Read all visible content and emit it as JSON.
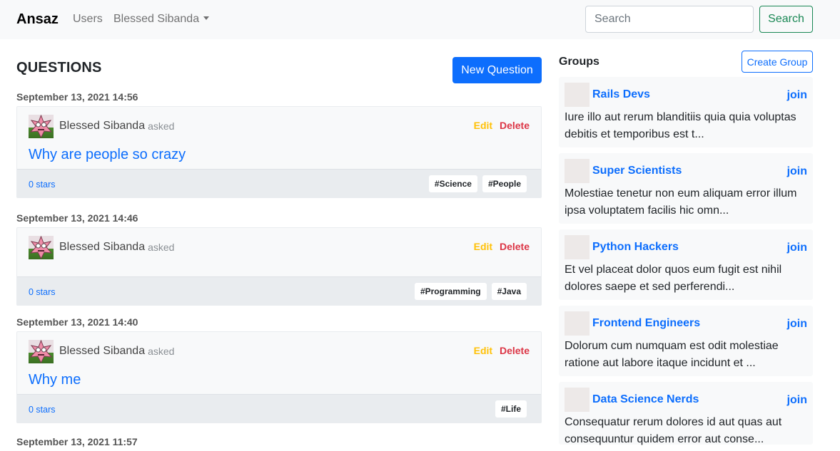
{
  "navbar": {
    "brand": "Ansaz",
    "users_link": "Users",
    "user_menu": "Blessed Sibanda",
    "search_placeholder": "Search",
    "search_button": "Search"
  },
  "questions": {
    "heading": "QUESTIONS",
    "new_button": "New Question",
    "edit_label": "Edit",
    "delete_label": "Delete",
    "items": [
      {
        "date": "September 13, 2021 14:56",
        "author": "Blessed Sibanda",
        "asked": "asked",
        "title": "Why are people so crazy",
        "stars": "0 stars",
        "tags": [
          "#Science",
          "#People"
        ]
      },
      {
        "date": "September 13, 2021 14:46",
        "author": "Blessed Sibanda",
        "asked": "asked",
        "title": "",
        "stars": "0 stars",
        "tags": [
          "#Programming",
          "#Java"
        ]
      },
      {
        "date": "September 13, 2021 14:40",
        "author": "Blessed Sibanda",
        "asked": "asked",
        "title": "Why me",
        "stars": "0 stars",
        "tags": [
          "#Life"
        ]
      },
      {
        "date": "September 13, 2021 11:57"
      }
    ]
  },
  "groups": {
    "heading": "Groups",
    "create_button": "Create Group",
    "join_label": "join",
    "items": [
      {
        "name": "Rails Devs",
        "description": "Iure illo aut rerum blanditiis quia quia voluptas debitis et temporibus est t..."
      },
      {
        "name": "Super Scientists",
        "description": "Molestiae tenetur non eum aliquam error illum ipsa voluptatem facilis hic omn..."
      },
      {
        "name": "Python Hackers",
        "description": "Et vel placeat dolor quos eum fugit est nihil dolores saepe et sed perferendi..."
      },
      {
        "name": "Frontend Engineers",
        "description": "Dolorum cum numquam est odit molestiae ratione aut labore itaque incidunt et ..."
      },
      {
        "name": "Data Science Nerds",
        "description": "Consequatur rerum dolores id aut quas aut consequuntur quidem error aut conse..."
      }
    ]
  },
  "colors": {
    "primary": "#0d6efd",
    "success": "#198754",
    "warning": "#ffc107",
    "danger": "#dc3545",
    "navbar_bg": "#f8f9fa"
  }
}
